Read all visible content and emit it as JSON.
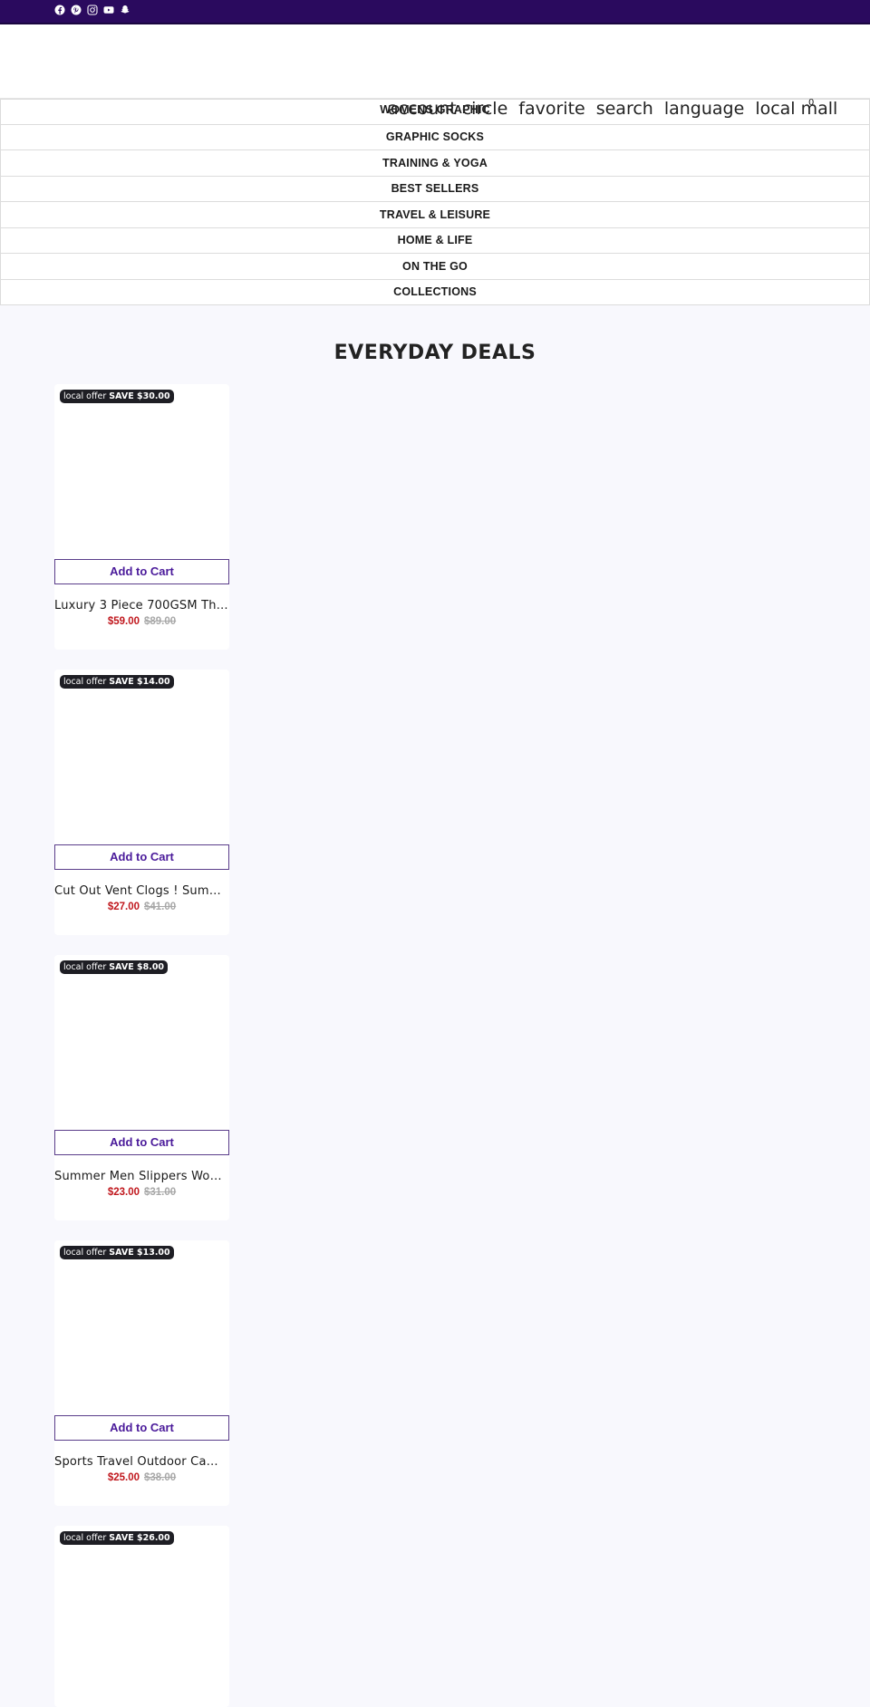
{
  "topbar": {
    "social_icons": [
      "facebook-icon",
      "pinterest-icon",
      "instagram-icon",
      "youtube-icon",
      "snapchat-icon"
    ]
  },
  "header": {
    "icons": [
      "account circle",
      "favorite",
      "search",
      "language",
      "local mall"
    ],
    "cart_count": "0"
  },
  "nav": {
    "items": [
      {
        "label": "WOMENS GRAPHIC"
      },
      {
        "label": "GRAPHIC SOCKS"
      },
      {
        "label": "TRAINING & YOGA"
      },
      {
        "label": "BEST SELLERS"
      },
      {
        "label": "TRAVEL & LEISURE"
      },
      {
        "label": "HOME & LIFE"
      },
      {
        "label": "ON THE GO"
      },
      {
        "label": "COLLECTIONS"
      }
    ]
  },
  "deals": {
    "title": "EVERYDAY DEALS",
    "products": [
      {
        "badge_icon": "local offer",
        "badge_save": "SAVE $30.00",
        "button": "Add to Cart",
        "title": "Luxury 3 Piece 700GSM Thi...",
        "price": "$59.00",
        "compare_price": "$89.00"
      },
      {
        "badge_icon": "local offer",
        "badge_save": "SAVE $14.00",
        "button": "Add to Cart",
        "title": "Cut Out Vent Clogs ! Summ...",
        "price": "$27.00",
        "compare_price": "$41.00"
      },
      {
        "badge_icon": "local offer",
        "badge_save": "SAVE $8.00",
        "button": "Add to Cart",
        "title": "Summer Men Slippers Wom...",
        "price": "$23.00",
        "compare_price": "$31.00"
      },
      {
        "badge_icon": "local offer",
        "badge_save": "SAVE $13.00",
        "button": "Add to Cart",
        "title": "Sports Travel Outdoor Cam...",
        "price": "$25.00",
        "compare_price": "$38.00"
      },
      {
        "badge_icon": "local offer",
        "badge_save": "SAVE $26.00"
      }
    ]
  },
  "colors": {
    "topbar": "#2a0a5e",
    "accent": "#4a1a9a",
    "sale_price": "#c0171d",
    "compare_price": "#a8a8a8",
    "badge_bg": "#1e1e24",
    "page_bg": "#f8f8fd"
  }
}
